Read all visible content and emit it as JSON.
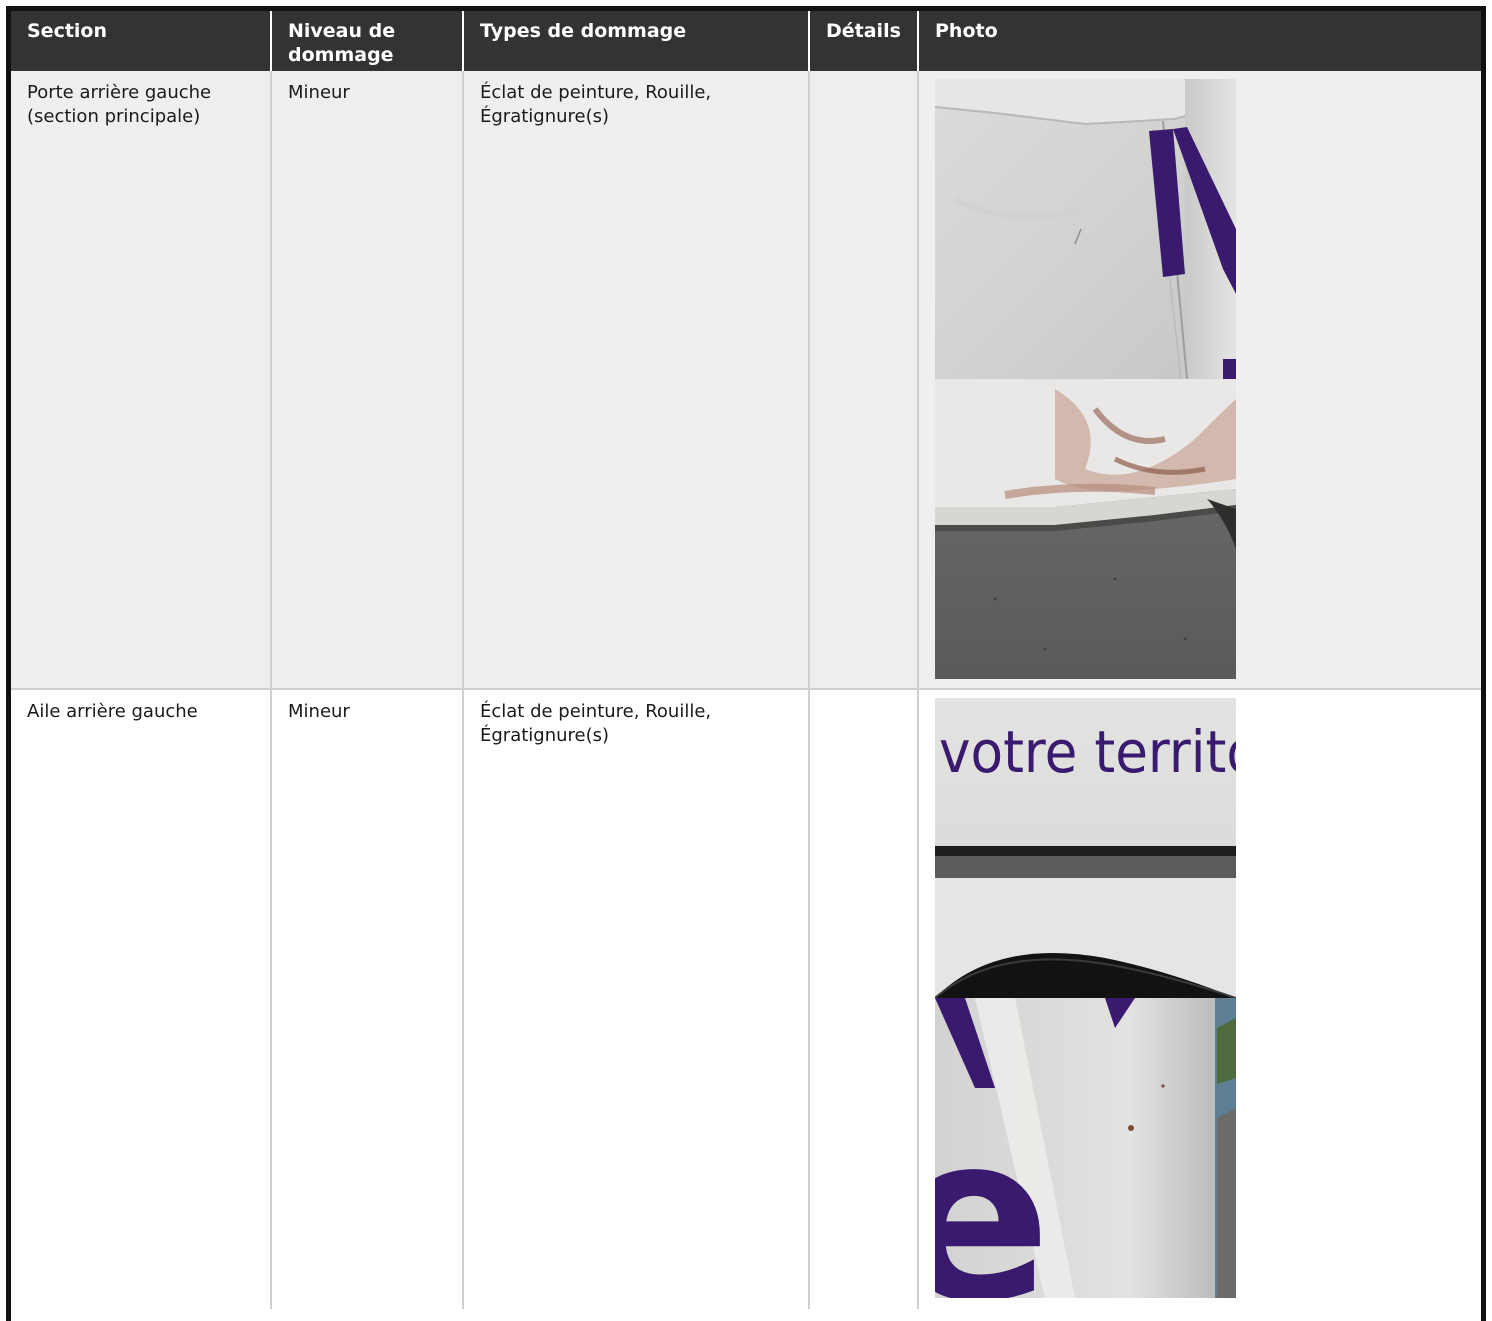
{
  "table": {
    "headers": [
      "Section",
      "Niveau de dommage",
      "Types de dommage",
      "Détails",
      "Photo"
    ],
    "rows": [
      {
        "section": "Porte arrière gauche (section principale)",
        "niveau": "Mineur",
        "types": "Éclat de peinture, Rouille, Égratignure(s)",
        "details": "",
        "photos": [
          "rear-door-lettering-photo",
          "rear-door-rust-photo"
        ]
      },
      {
        "section": "Aile arrière gauche",
        "niveau": "Mineur",
        "types": "Éclat de peinture, Rouille, Égratignure(s)",
        "details": "",
        "photos": [
          {
            "subject": "rear-wing-lettering-photo",
            "visible_text": "votre territo"
          },
          {
            "subject": "rear-wing-panel-photo",
            "visible_text": "e"
          }
        ]
      }
    ]
  },
  "colors": {
    "header_bg": "#333333",
    "row_alt_bg": "#efefef",
    "lettering_purple": "#3a1a6e"
  }
}
